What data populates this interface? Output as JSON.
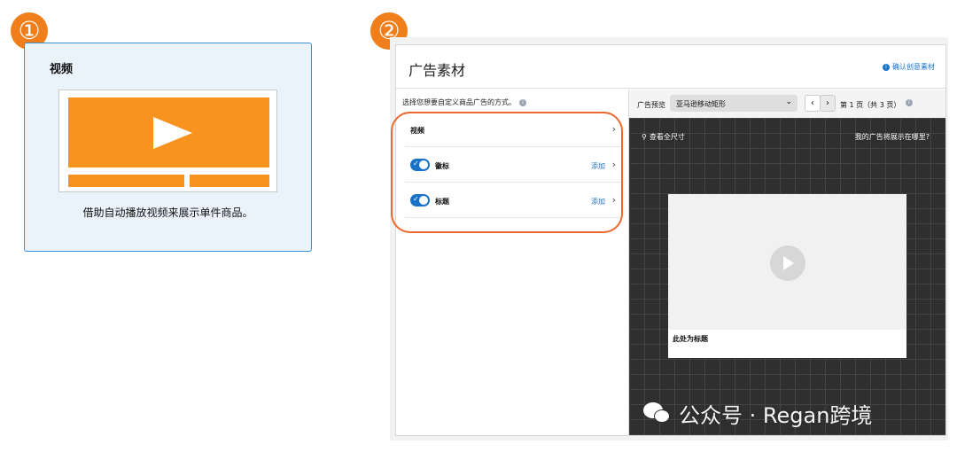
{
  "steps": {
    "one": "①",
    "two": "②"
  },
  "card1": {
    "title": "视频",
    "description": "借助自动播放视频来展示单件商品。",
    "accent_color": "#f7931e"
  },
  "panel": {
    "title": "广告素材",
    "help_link": "确认创意素材",
    "left": {
      "prompt": "选择您想要自定义商品广告的方式。",
      "options": [
        {
          "label": "视频",
          "chevron": "›"
        },
        {
          "label": "徽标",
          "toggle": "on",
          "action": "添加",
          "chevron": "›"
        },
        {
          "label": "标题",
          "toggle": "on",
          "action": "添加",
          "chevron": "›"
        }
      ]
    },
    "preview": {
      "label": "广告预览",
      "placement": "亚马逊移动矩形",
      "prev": "‹",
      "next": "›",
      "page": "第 1 页（共 3 页）",
      "full_size": "查看全尺寸",
      "where": "我的广告将展示在哪里?",
      "ad_title": "此处为标题"
    }
  },
  "watermark": "公众号 · Regan跨境",
  "colors": {
    "highlight": "#ec6a2e",
    "link": "#1a73c7",
    "badge": "#f07e1a"
  }
}
